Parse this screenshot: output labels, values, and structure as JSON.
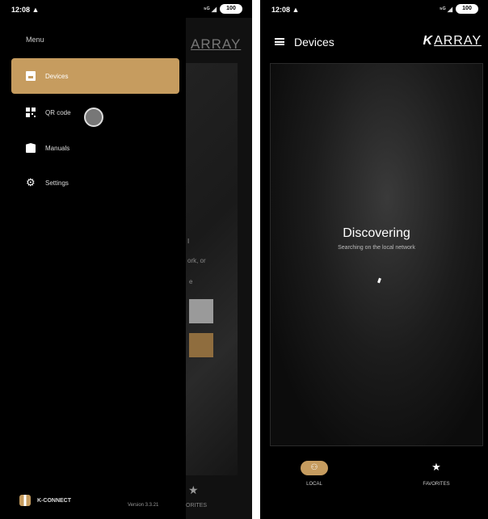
{
  "left_screen": {
    "status": {
      "time": "12:08 ▲",
      "signal": "⁵ᴳ ◢",
      "battery": "100"
    },
    "background_app": {
      "logo": "ARRAY",
      "fragment_1": "I",
      "fragment_2": "ork, or",
      "fragment_3": "e",
      "favorites_label": "ORITES"
    },
    "drawer": {
      "title": "Menu",
      "items": [
        {
          "label": "Devices",
          "icon": "device-icon",
          "active": true
        },
        {
          "label": "QR code",
          "icon": "qr-code-icon",
          "active": false
        },
        {
          "label": "Manuals",
          "icon": "manual-book-icon",
          "active": false
        },
        {
          "label": "Settings",
          "icon": "gear-icon",
          "active": false
        }
      ],
      "brand": "K-CONNECT",
      "version": "Version 3.3.21"
    }
  },
  "right_screen": {
    "status": {
      "time": "12:08 ▲",
      "signal": "⁵ᴳ ◢",
      "battery": "100"
    },
    "appbar": {
      "title": "Devices",
      "logo_k": "K",
      "logo_text": "ARRAY"
    },
    "discovering": {
      "title": "Discovering",
      "subtitle": "Searching on the local network"
    },
    "bottom_nav": {
      "local": {
        "label": "LOCAL",
        "icon": "network-icon"
      },
      "favorites": {
        "label": "FAVORITES",
        "icon": "star-icon"
      }
    }
  },
  "colors": {
    "accent": "#c69c5f",
    "background": "#000000"
  }
}
